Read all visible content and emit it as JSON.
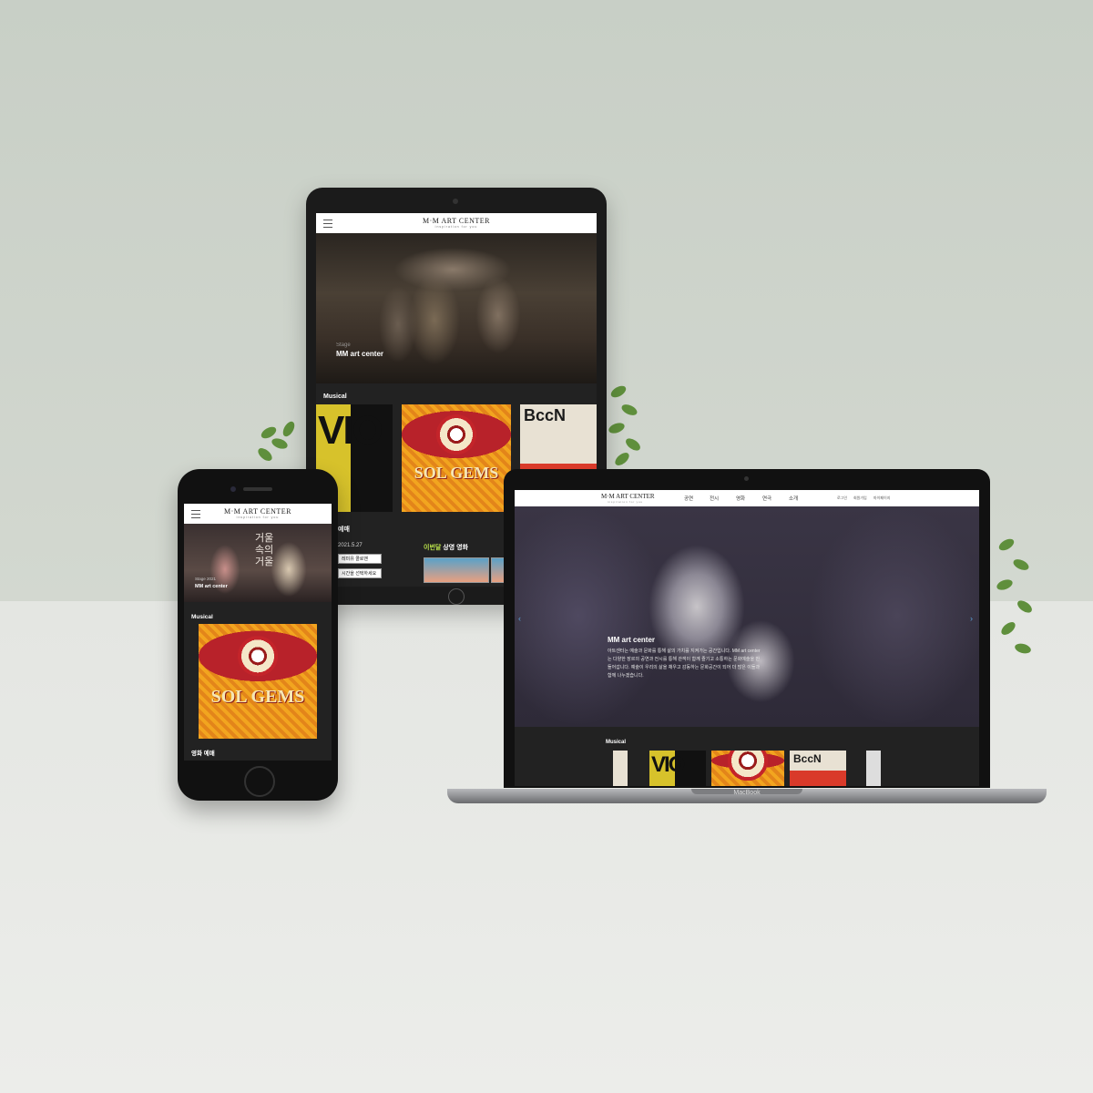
{
  "site": {
    "logo": "M·M ART CENTER",
    "logo_sub": "inspiration for you"
  },
  "tablet": {
    "hero_small": "Stage",
    "hero_title": "MM art center",
    "musical_label": "Musical",
    "booking_label": "예매",
    "date": "2021.5.27",
    "select1": "레미유 콜로맨",
    "select2": "시간을 선택하세요",
    "this_month_hl": "이번달",
    "this_month_rest": " 상영 영화",
    "poster_vio": "VIO",
    "poster_sol": "SOL GEMS",
    "poster_bcc": "BccN"
  },
  "phone": {
    "poem": [
      "거울",
      "속의",
      "거울"
    ],
    "hero_small": "Stage 2021",
    "hero_title": "MM art center",
    "musical_label": "Musical",
    "movie_label": "영화 예매",
    "poster_sol": "SOL GEMS"
  },
  "laptop": {
    "brand": "MacBook",
    "nav": [
      "공연",
      "전시",
      "영화",
      "연극",
      "소개"
    ],
    "util": [
      "로그인",
      "회원가입",
      "마이페이지"
    ],
    "hero_title": "MM art center",
    "hero_body": "아트센터는 예술과 문화를 통해 삶의 가치를 지켜가는 공간입니다. MM art center는 다양한 장르의 공연과 전시를 통해 관객이 함께 즐기고 소통하는 문화예술을 만들어갑니다. 예술이 우리의 삶을 채우고 감동하는 문화공간이 되어 더 많은 이들과 함께 나누겠습니다.",
    "musical_label": "Musical",
    "poster_bcc": "BccN",
    "poster_vio": "VIO"
  }
}
